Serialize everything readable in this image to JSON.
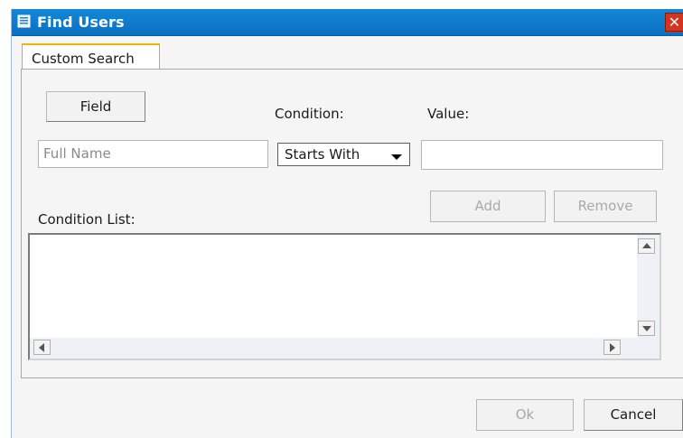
{
  "window": {
    "title": "Find Users",
    "close_glyph": "✕"
  },
  "tabs": [
    {
      "label": "Custom Search"
    }
  ],
  "search": {
    "field_button": "Field",
    "condition_label": "Condition:",
    "value_label": "Value:",
    "field_input_placeholder": "Full Name",
    "condition_selected": "Starts With",
    "value_input": ""
  },
  "condition_list": {
    "label": "Condition List:",
    "add_button": "Add",
    "remove_button": "Remove",
    "items": []
  },
  "footer": {
    "ok_button": "Ok",
    "cancel_button": "Cancel"
  },
  "colors": {
    "titlebar": "#0b6fc2",
    "tab_accent": "#f1b600",
    "close_button": "#d4341f"
  }
}
